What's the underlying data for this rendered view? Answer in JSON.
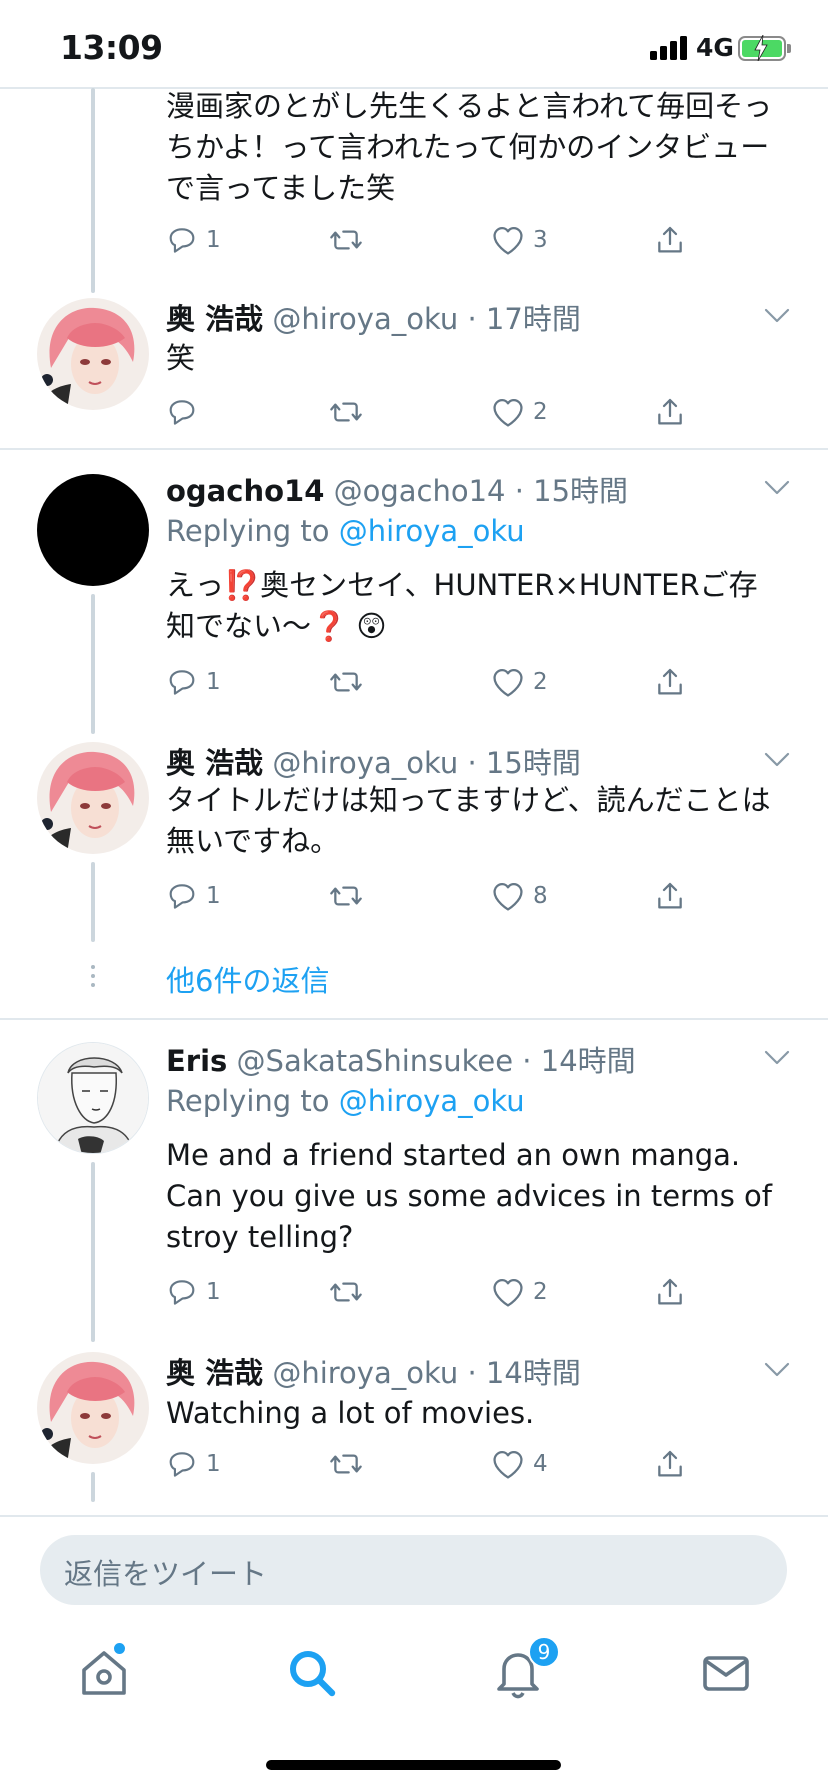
{
  "status_bar": {
    "time": "13:09",
    "network": "4G"
  },
  "tweets": [
    {
      "text": "漫画家のとがし先生くるよと言われて毎回そっちかよ！って言われたって何かのインタビューで言ってました笑",
      "reply_count": "1",
      "like_count": "3"
    },
    {
      "name": "奥 浩哉",
      "handle": "@hiroya_oku",
      "time": "17時間",
      "text": "笑",
      "like_count": "2"
    },
    {
      "name": "ogacho14",
      "handle": "@ogacho14",
      "time": "15時間",
      "replying_prefix": "Replying to",
      "replying_to": "@hiroya_oku",
      "text": "えっ⁉️奥センセイ、HUNTER×HUNTERご存知でない〜❓ 😲",
      "reply_count": "1",
      "like_count": "2"
    },
    {
      "name": "奥 浩哉",
      "handle": "@hiroya_oku",
      "time": "15時間",
      "text": "タイトルだけは知ってますけど、読んだことは無いですね。",
      "reply_count": "1",
      "like_count": "8"
    },
    {
      "name": "Eris",
      "handle": "@SakataShinsukee",
      "time": "14時間",
      "replying_prefix": "Replying to",
      "replying_to": "@hiroya_oku",
      "text": "Me and a friend started an own manga. Can you give us some advices in terms of stroy telling?",
      "reply_count": "1",
      "like_count": "2"
    },
    {
      "name": "奥 浩哉",
      "handle": "@hiroya_oku",
      "time": "14時間",
      "text": "Watching a lot of movies.",
      "reply_count": "1",
      "like_count": "4"
    }
  ],
  "more_replies": "他6件の返信",
  "reply_box": {
    "placeholder": "返信をツイート"
  },
  "nav": {
    "items": [
      "home-icon",
      "search-icon",
      "notifications-icon",
      "messages-icon"
    ],
    "notification_badge": "9"
  },
  "colors": {
    "accent": "#1da1f2",
    "secondary_text": "#657786",
    "divider": "#e1e8ed",
    "battery": "#4cd964"
  }
}
